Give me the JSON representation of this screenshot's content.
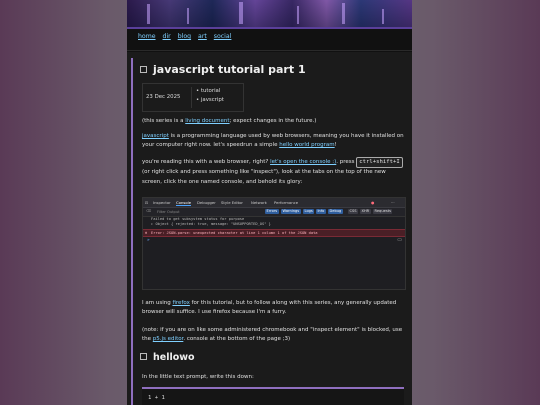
{
  "nav": [
    "home",
    "dir",
    "blog",
    "art",
    "social"
  ],
  "post": {
    "title": "javascript tutorial part 1",
    "date": "23 Dec 2025",
    "tags": [
      "tutorial",
      "javscript"
    ]
  },
  "p1": {
    "pre": "(this series is a ",
    "link": "living document",
    "post": "; expect changes in the future.)"
  },
  "p2": {
    "link1": "javascript",
    "mid": " is a programming language used by web browsers, meaning you have it installed on your computer right now. let's speedrun a simple ",
    "link2": "hello world program",
    "post": "!"
  },
  "p3": {
    "pre": "you're reading this with a web browser, right? ",
    "link": "let's open the console :)",
    "mid1": ". press ",
    "kbd": "ctrl+shift+I",
    "post": " (or right click and press something like \"inspect\"), look at the tabs on the top of the new screen, click the one named console, and behold its glory:"
  },
  "devtools": {
    "tabs": [
      "Inspector",
      "Console",
      "Debugger",
      "Style Editor",
      "Network",
      "Performance"
    ],
    "active_tab": "Console",
    "filter_placeholder": "Filter Output",
    "chips": [
      "Errors",
      "Warnings",
      "Logs",
      "Info",
      "Debug",
      "CSS",
      "XHR",
      "Requests"
    ],
    "line1": "Failed to get subsystem status for purpose",
    "line2": "▸ Object { rejected: true, message: \"UNSUPPORTED_OS\" }",
    "error": "Error: JSON.parse: unexpected character at line 1 column 1 of the JSON data",
    "prompt": "»"
  },
  "p4": {
    "pre": "I am using ",
    "link": "firefox",
    "post": " for this tutorial, but to follow along with this series, any generally updated browser will suffice. I use firefox because I'm a furry."
  },
  "p5": {
    "pre": "(note: if you are on like some administered chromebook and \"inspect element\" is blocked, use the ",
    "link": "p5.js editor",
    "post": ". console at the bottom of the page ;3)"
  },
  "h2": "hellowo",
  "p6": "In the little text prompt, write this down:",
  "code": "1 + 1",
  "colors": {
    "accent": "#8f6fbf",
    "link": "#7fd0ff",
    "error_bg": "#4a1f26"
  }
}
